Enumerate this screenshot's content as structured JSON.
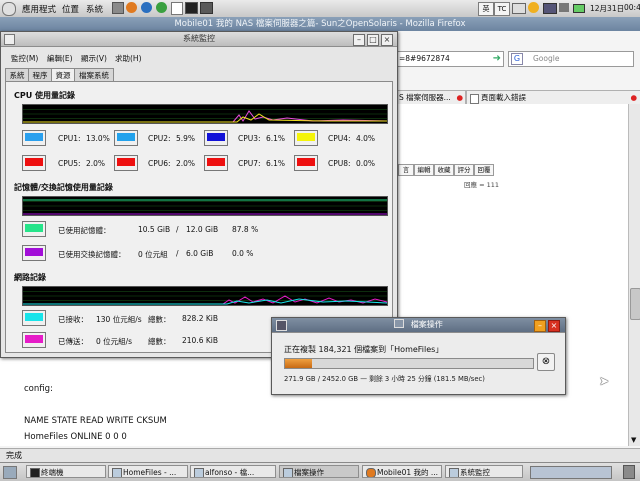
{
  "top_panel": {
    "menus": [
      "應用程式",
      "位置",
      "系統"
    ],
    "input_method": "英",
    "input_mode": "TC",
    "date": "12月31日",
    "time": "00:42"
  },
  "firefox": {
    "title": "Mobile01 我的 NAS 檔案伺服器之篇- Sun之OpenSolaris - Mozilla Firefox",
    "url_fragment": "=8#9672874",
    "search_placeholder": "Google",
    "tabs": [
      "S 檔案伺服器...",
      "頁面載入錯誤"
    ],
    "toolbar_buttons": [
      "言",
      "編輯",
      "收藏",
      "評分",
      "回覆"
    ],
    "reply_count": "回應 = 111",
    "content_lines": [
      "config:",
      "NAME STATE READ WRITE CKSUM",
      "HomeFiles ONLINE 0 0 0"
    ],
    "status": "完成"
  },
  "sysmon": {
    "title": "系統監控",
    "menu": [
      "監控(M)",
      "編輯(E)",
      "顯示(V)",
      "求助(H)"
    ],
    "tabs": [
      "系統",
      "程序",
      "資源",
      "檔案系統"
    ],
    "cpu_title": "CPU 使用量記錄",
    "cpus": [
      {
        "label": "CPU1:",
        "value": "13.0%",
        "color": "#2aa0ee"
      },
      {
        "label": "CPU2:",
        "value": "5.9%",
        "color": "#22a2ec"
      },
      {
        "label": "CPU3:",
        "value": "6.1%",
        "color": "#1212d8"
      },
      {
        "label": "CPU4:",
        "value": "4.0%",
        "color": "#f4f40a"
      },
      {
        "label": "CPU5:",
        "value": "2.0%",
        "color": "#ee1010"
      },
      {
        "label": "CPU6:",
        "value": "2.0%",
        "color": "#ee1010"
      },
      {
        "label": "CPU7:",
        "value": "6.1%",
        "color": "#ee1010"
      },
      {
        "label": "CPU8:",
        "value": "0.0%",
        "color": "#ee1010"
      }
    ],
    "mem_title": "記憶體/交換記憶使用量記錄",
    "mem": {
      "label": "已使用記憶體：",
      "used": "10.5 GiB",
      "sep": "/",
      "total": "12.0 GiB",
      "pct": "87.8 %",
      "color": "#26e48a"
    },
    "swap": {
      "label": "已使用交換記憶體：",
      "used": "0 位元組",
      "sep": "/",
      "total": "6.0 GiB",
      "pct": "0.0 %",
      "color": "#a20ed8"
    },
    "net_title": "網路記錄",
    "recv": {
      "label": "已接收：",
      "rate": "130 位元組/s",
      "total_label": "總數：",
      "total": "828.2 KiB",
      "color": "#18e4ea"
    },
    "sent": {
      "label": "已傳送：",
      "rate": "0 位元組/s",
      "total_label": "總數：",
      "total": "210.6 KiB",
      "color": "#e61cc8"
    }
  },
  "fileop": {
    "title": "檔案操作",
    "message": "正在複製 184,321 個檔案到「HomeFiles」",
    "progress": 0.11,
    "detail": "271.9 GB / 2452.0 GB — 剩餘 3 小時 25 分鐘 (181.5 MB/sec)"
  },
  "taskbar": {
    "tasks": [
      "終端機",
      "HomeFiles - ...",
      "alfonso - 檔...",
      "檔案操作",
      "Mobile01 我的 ...",
      "系統監控"
    ]
  }
}
